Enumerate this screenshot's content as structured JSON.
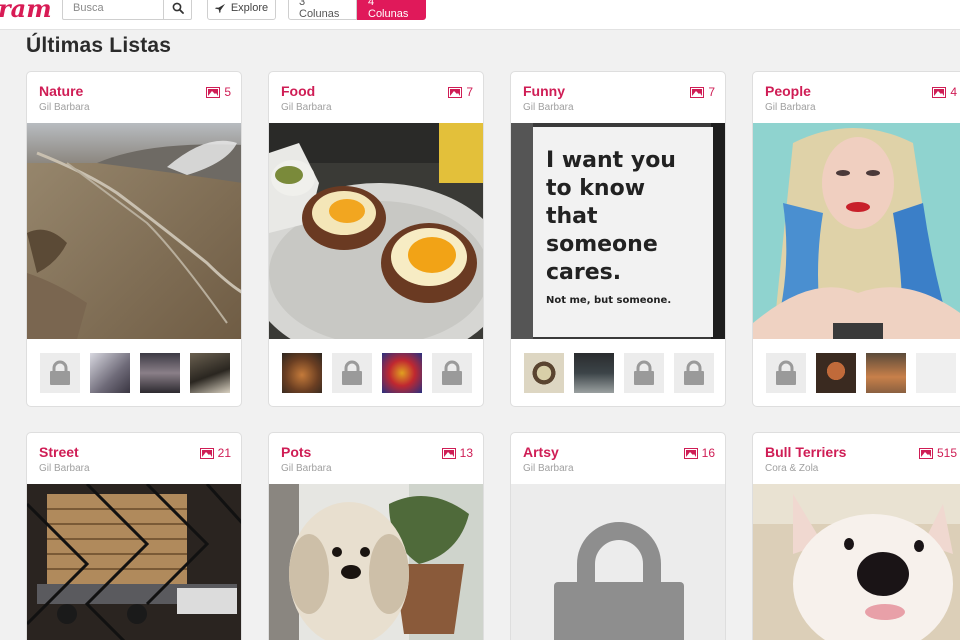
{
  "header": {
    "logo_text": "ram",
    "search_placeholder": "Busca",
    "search_icon": "search-icon",
    "explore_label": "Explore",
    "explore_icon": "rocket-icon",
    "column_options": [
      "3 Colunas",
      "4 Colunas"
    ],
    "selected_columns": "4 Colunas",
    "accent_color": "#e0195a"
  },
  "page_title": "Últimas Listas",
  "cards": [
    {
      "title": "Nature",
      "author": "Gil Barbara",
      "count": "5",
      "count_icon": "image-icon",
      "thumbs": [
        "lock",
        "photo",
        "photo",
        "photo"
      ]
    },
    {
      "title": "Food",
      "author": "Gil Barbara",
      "count": "7",
      "count_icon": "image-icon",
      "thumbs": [
        "photo",
        "lock",
        "photo",
        "lock"
      ]
    },
    {
      "title": "Funny",
      "author": "Gil Barbara",
      "count": "7",
      "count_icon": "image-icon",
      "thumbs": [
        "photo",
        "photo",
        "lock",
        "lock"
      ],
      "sign_text": [
        "I want you",
        "to know",
        "that",
        "someone",
        "cares."
      ],
      "sign_subtext": "Not me, but someone."
    },
    {
      "title": "People",
      "author": "Gil Barbara",
      "count": "4",
      "count_icon": "image-icon",
      "thumbs": [
        "lock",
        "photo",
        "photo",
        "empty"
      ]
    },
    {
      "title": "Street",
      "author": "Gil Barbara",
      "count": "21",
      "count_icon": "image-icon"
    },
    {
      "title": "Pots",
      "author": "Gil Barbara",
      "count": "13",
      "count_icon": "image-icon"
    },
    {
      "title": "Artsy",
      "author": "Gil Barbara",
      "count": "16",
      "count_icon": "image-icon",
      "locked": true
    },
    {
      "title": "Bull Terriers",
      "author": "Cora & Zola",
      "count": "515",
      "count_icon": "image-icon"
    }
  ]
}
